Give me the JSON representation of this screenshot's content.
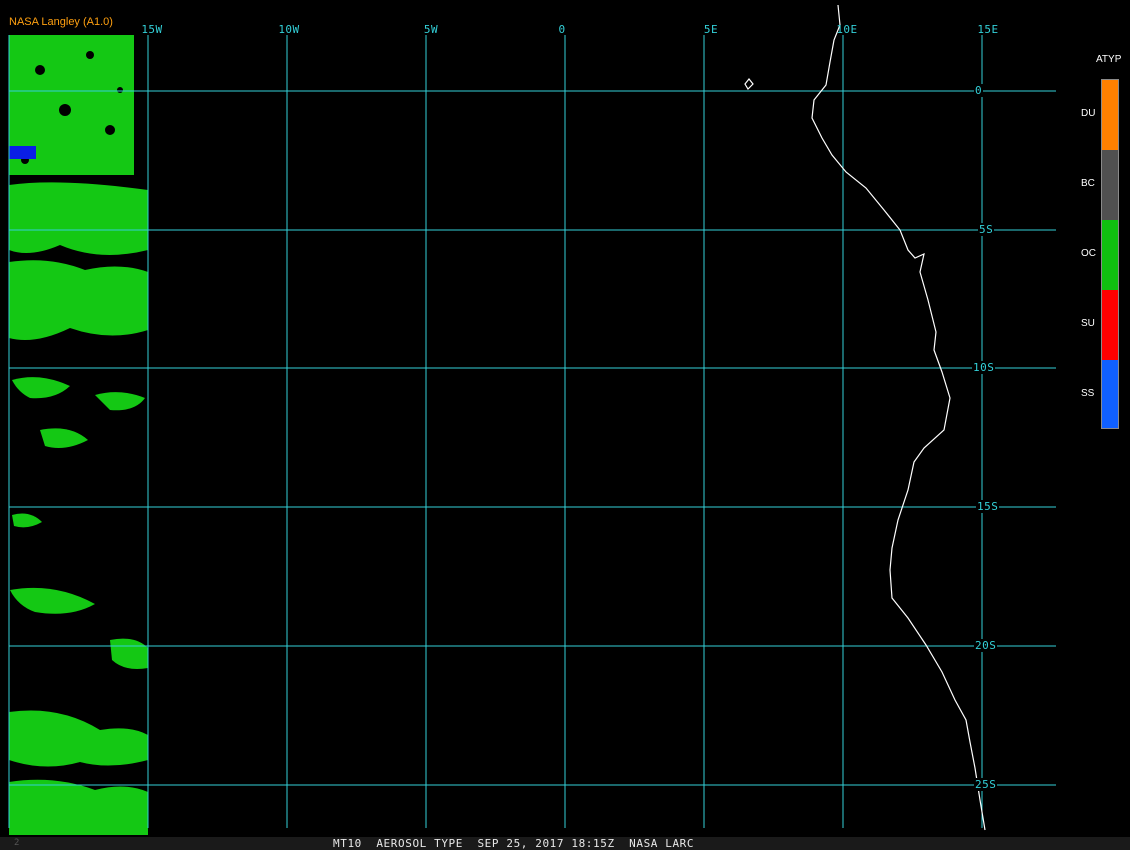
{
  "credit": "NASA Langley (A1.0)",
  "footer": {
    "corner": "2",
    "text": "MT10  AEROSOL TYPE  SEP 25, 2017 18:15Z  NASA LARC"
  },
  "longitude_labels": [
    "15W",
    "10W",
    "5W",
    "0",
    "5E",
    "10E",
    "15E"
  ],
  "latitude_labels": [
    "0",
    "5S",
    "10S",
    "15S",
    "20S",
    "25S"
  ],
  "legend": {
    "title": "ATYP",
    "items": [
      {
        "label": "DU",
        "color": "#ff8000"
      },
      {
        "label": "BC",
        "color": "#505050"
      },
      {
        "label": "OC",
        "color": "#10c010"
      },
      {
        "label": "SU",
        "color": "#ff0000"
      },
      {
        "label": "SS",
        "color": "#1060ff"
      }
    ]
  },
  "colors": {
    "grid": "#33d0d8",
    "coast": "#ffffff",
    "aerosol_oc": "#14c814",
    "aerosol_ss": "#0a1ee6",
    "credit": "#ffa010"
  }
}
